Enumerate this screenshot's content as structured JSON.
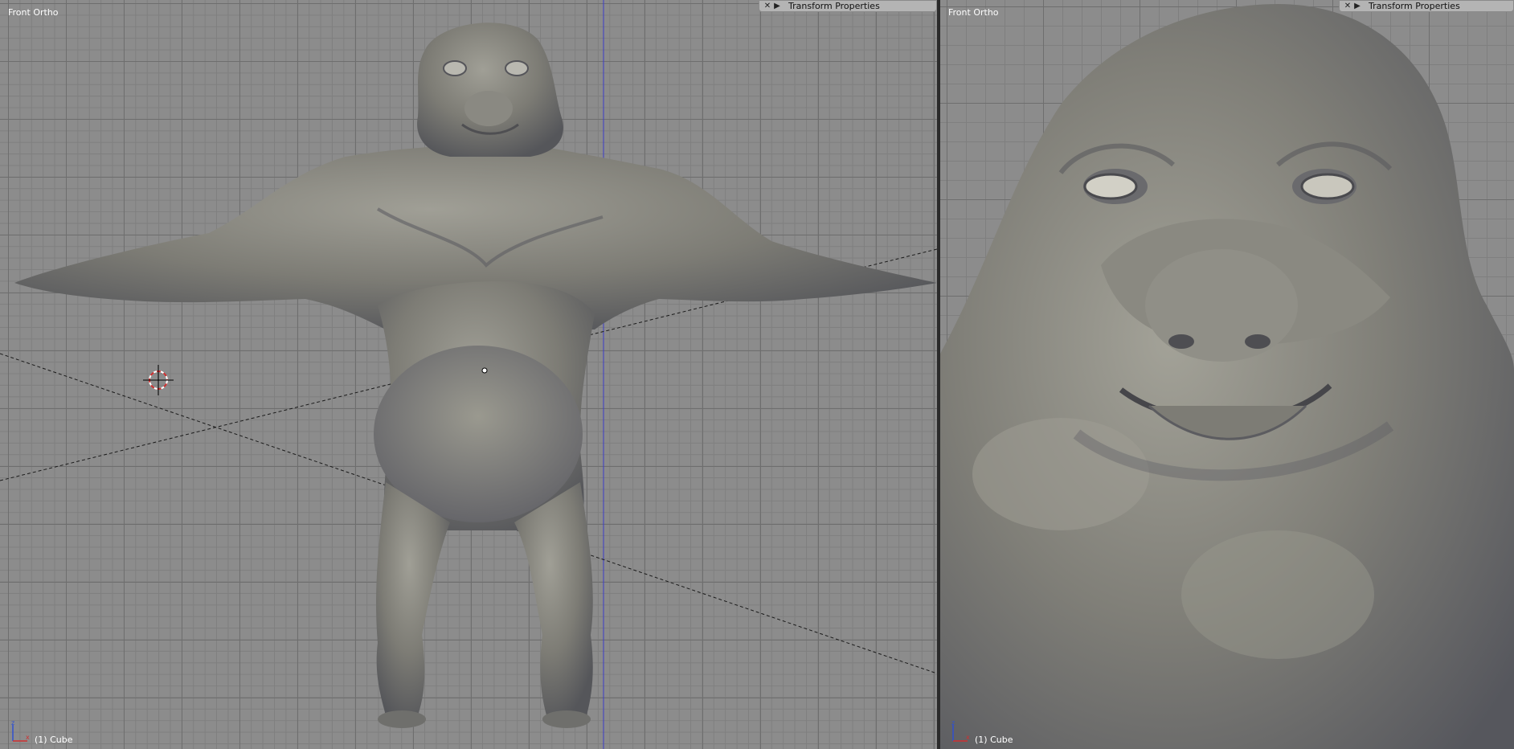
{
  "viewports": {
    "left": {
      "view_label": "Front Ortho",
      "object_label": "(1) Cube",
      "panel": {
        "close": "✕",
        "toggle": "▶",
        "title": "Transform Properties"
      }
    },
    "right": {
      "view_label": "Front Ortho",
      "object_label": "(1) Cube",
      "panel": {
        "close": "✕",
        "toggle": "▶",
        "title": "Transform Properties"
      }
    }
  },
  "axis_labels": {
    "x": "x",
    "z": "z"
  },
  "colors": {
    "grid_bg": "#8c8c8c",
    "mesh": "#7b7a73",
    "panel": "#b4b4b4",
    "axis_x": "#d03030",
    "axis_z": "#3050d0"
  }
}
